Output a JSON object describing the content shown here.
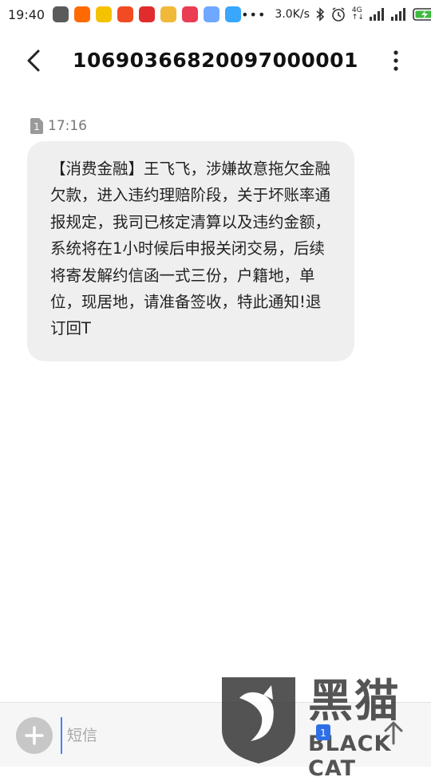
{
  "status_bar": {
    "time": "19:40",
    "network_speed": "3.0K/s",
    "network_type": "4G",
    "app_icons": [
      {
        "name": "mi-store-icon",
        "color": "#5a5a5a"
      },
      {
        "name": "xiaomi-icon",
        "color": "#ff6a00"
      },
      {
        "name": "app-n-icon",
        "color": "#f5c200"
      },
      {
        "name": "listen-icon",
        "color": "#f24a22"
      },
      {
        "name": "news-icon",
        "color": "#e02c2c"
      },
      {
        "name": "game-icon",
        "color": "#f0b93a"
      },
      {
        "name": "ban-icon",
        "color": "#ea3c53"
      },
      {
        "name": "chat-icon",
        "color": "#6fa8ff"
      },
      {
        "name": "download-icon",
        "color": "#3aa7ff"
      }
    ]
  },
  "header": {
    "title": "10690366820097000001"
  },
  "message": {
    "sim": "1",
    "time": "17:16",
    "text": "【消费金融】王飞飞，涉嫌故意拖欠金融欠款，进入违约理赔阶段，关于坏账率通报规定，我司已核定清算以及违约金额，系统将在1小时候后申报关闭交易，后续将寄发解约信函一式三份，户籍地，单位，现居地，请准备签收，特此通知!退订回T"
  },
  "input_bar": {
    "placeholder": "短信",
    "sim": "1"
  },
  "watermark": {
    "cn": "黑猫",
    "en": "BLACK CAT"
  },
  "colors": {
    "bubble": "#efefef",
    "cursor": "#4a7cff"
  }
}
